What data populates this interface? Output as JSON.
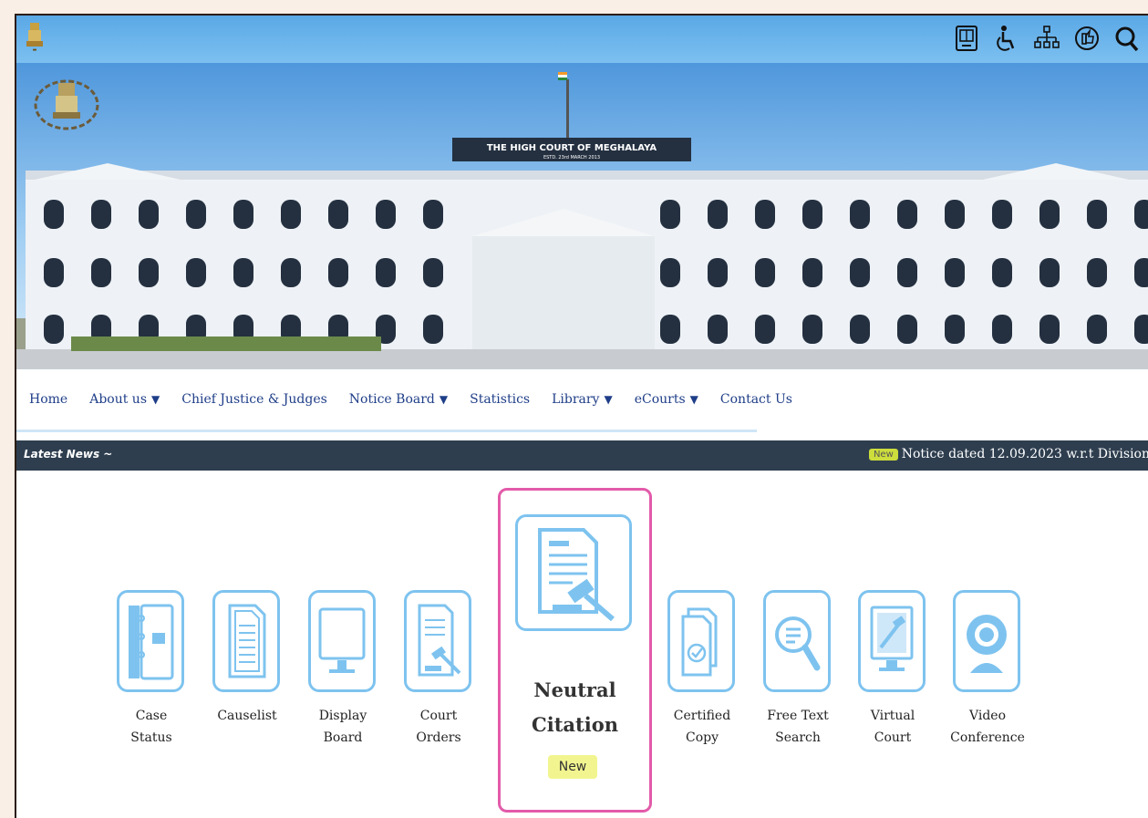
{
  "banner": {
    "building_sign_line1": "THE HIGH COURT OF MEGHALAYA",
    "building_sign_line2": "ESTD. 23rd MARCH 2013"
  },
  "toolbar": {
    "icons": [
      "screen-reader-icon",
      "accessibility-icon",
      "sitemap-icon",
      "feedback-icon",
      "search-icon"
    ]
  },
  "nav": {
    "items": [
      {
        "label": "Home",
        "dropdown": false
      },
      {
        "label": "About us",
        "dropdown": true
      },
      {
        "label": "Chief Justice & Judges",
        "dropdown": false
      },
      {
        "label": "Notice Board",
        "dropdown": true
      },
      {
        "label": "Statistics",
        "dropdown": false
      },
      {
        "label": "Library",
        "dropdown": true
      },
      {
        "label": "eCourts",
        "dropdown": true
      },
      {
        "label": "Contact Us",
        "dropdown": false
      }
    ],
    "dropdown_arrow": "▼"
  },
  "news": {
    "label": "Latest News ~",
    "badge": "New",
    "ticker": "Notice dated 12.09.2023 w.r.t Division"
  },
  "services": [
    {
      "line1": "Case",
      "line2": "Status",
      "icon": "case-status-icon"
    },
    {
      "line1": "Causelist",
      "line2": "",
      "icon": "causelist-icon"
    },
    {
      "line1": "Display",
      "line2": "Board",
      "icon": "display-board-icon"
    },
    {
      "line1": "Court",
      "line2": "Orders",
      "icon": "court-orders-icon"
    },
    {
      "line1": "Certified",
      "line2": "Copy",
      "icon": "certified-copy-icon"
    },
    {
      "line1": "Free Text",
      "line2": "Search",
      "icon": "free-text-search-icon"
    },
    {
      "line1": "Virtual",
      "line2": "Court",
      "icon": "virtual-court-icon"
    },
    {
      "line1": "Video",
      "line2": "Conference",
      "icon": "video-conference-icon"
    }
  ],
  "featured": {
    "line1": "Neutral",
    "line2": "Citation",
    "badge": "New",
    "icon": "neutral-citation-icon"
  },
  "colors": {
    "accent_blue": "#7ec3ef",
    "news_bar": "#2e3e4f",
    "featured_border": "#e35aa9",
    "badge_yellow": "#f2f58f"
  }
}
